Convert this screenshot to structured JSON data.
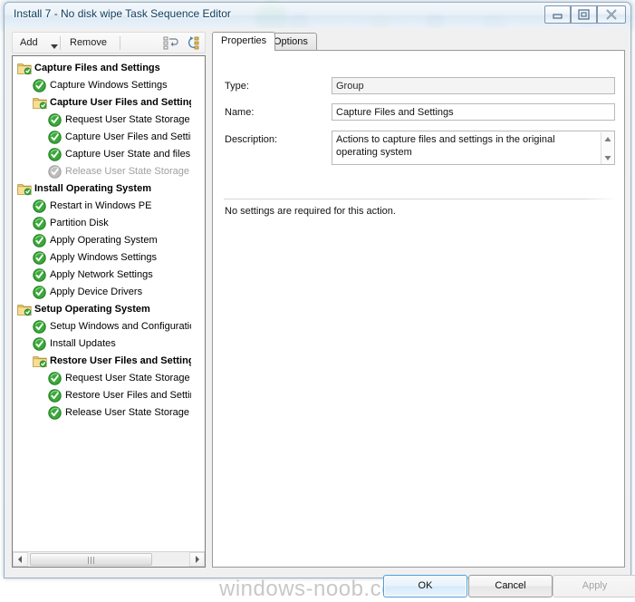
{
  "window": {
    "title": "Install 7 - No disk wipe Task Sequence Editor",
    "controls": {
      "minimize": "minimize-button",
      "maximize": "restore-button",
      "close": "close-button"
    }
  },
  "toolbar": {
    "add_label": "Add",
    "add_caret": "▾",
    "remove_label": "Remove",
    "icon_undo": "undo-list-icon",
    "icon_redo": "redo-list-icon"
  },
  "tree": {
    "nodes": [
      {
        "label": "Capture Files and Settings",
        "indent": 0,
        "type": "group",
        "bold": true,
        "disabled": false
      },
      {
        "label": "Capture Windows Settings",
        "indent": 1,
        "type": "action",
        "bold": false,
        "disabled": false
      },
      {
        "label": "Capture User Files and Settings",
        "indent": 1,
        "type": "group",
        "bold": true,
        "disabled": false
      },
      {
        "label": "Request User State Storage",
        "indent": 2,
        "type": "action",
        "bold": false,
        "disabled": false
      },
      {
        "label": "Capture User Files and Settings",
        "indent": 2,
        "type": "action",
        "bold": false,
        "disabled": false
      },
      {
        "label": "Capture User State and files in",
        "indent": 2,
        "type": "action",
        "bold": false,
        "disabled": false
      },
      {
        "label": "Release User State Storage",
        "indent": 2,
        "type": "action",
        "bold": false,
        "disabled": true
      },
      {
        "label": "Install Operating System",
        "indent": 0,
        "type": "group",
        "bold": true,
        "disabled": false
      },
      {
        "label": "Restart in Windows PE",
        "indent": 1,
        "type": "action",
        "bold": false,
        "disabled": false
      },
      {
        "label": "Partition Disk",
        "indent": 1,
        "type": "action",
        "bold": false,
        "disabled": false
      },
      {
        "label": "Apply Operating System",
        "indent": 1,
        "type": "action",
        "bold": false,
        "disabled": false
      },
      {
        "label": "Apply Windows Settings",
        "indent": 1,
        "type": "action",
        "bold": false,
        "disabled": false
      },
      {
        "label": "Apply Network Settings",
        "indent": 1,
        "type": "action",
        "bold": false,
        "disabled": false
      },
      {
        "label": "Apply Device Drivers",
        "indent": 1,
        "type": "action",
        "bold": false,
        "disabled": false
      },
      {
        "label": "Setup Operating System",
        "indent": 0,
        "type": "group",
        "bold": true,
        "disabled": false
      },
      {
        "label": "Setup Windows and Configuration",
        "indent": 1,
        "type": "action",
        "bold": false,
        "disabled": false
      },
      {
        "label": "Install Updates",
        "indent": 1,
        "type": "action",
        "bold": false,
        "disabled": false
      },
      {
        "label": "Restore User Files and Settings",
        "indent": 1,
        "type": "group",
        "bold": true,
        "disabled": false
      },
      {
        "label": "Request User State Storage",
        "indent": 2,
        "type": "action",
        "bold": false,
        "disabled": false
      },
      {
        "label": "Restore User Files and Settings",
        "indent": 2,
        "type": "action",
        "bold": false,
        "disabled": false
      },
      {
        "label": "Release User State Storage",
        "indent": 2,
        "type": "action",
        "bold": false,
        "disabled": false
      }
    ],
    "hscroll": {
      "left_arrow": "◂",
      "right_arrow": "▸",
      "grip": "‖‖"
    }
  },
  "tabs": [
    {
      "label": "Properties",
      "active": true
    },
    {
      "label": "Options",
      "active": false
    }
  ],
  "properties": {
    "type_label": "Type:",
    "type_value": "Group",
    "name_label": "Name:",
    "name_value": "Capture Files and Settings",
    "description_label": "Description:",
    "description_value": "Actions to capture files and settings in the original operating system",
    "scroll_up": "▴",
    "scroll_down": "▾",
    "no_settings_text": "No settings are required  for this action."
  },
  "footer": {
    "ok_label": "OK",
    "cancel_label": "Cancel",
    "apply_label": "Apply"
  },
  "watermark": "windows-noob.com",
  "colors": {
    "accent": "#4c9ed9",
    "folder": "#f2cd72",
    "check_green": "#2fa02f",
    "disabled_gray": "#a0a0a0",
    "title_text": "#0b3c5d"
  }
}
